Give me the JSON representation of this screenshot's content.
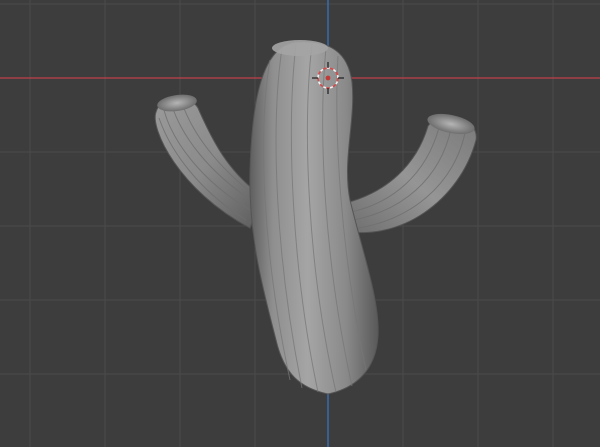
{
  "viewport": {
    "view": "3D Viewport",
    "background_color": "#3d3d3d",
    "grid_color": "#4b4b4b",
    "x_axis_color": "#c2404d",
    "y_axis_color": "#3a6fb7",
    "object_color": "#8a8a8a",
    "object": "cactus-mesh",
    "object_parts": [
      "trunk",
      "left-arm",
      "right-arm"
    ],
    "cursor": "3d-cursor"
  }
}
